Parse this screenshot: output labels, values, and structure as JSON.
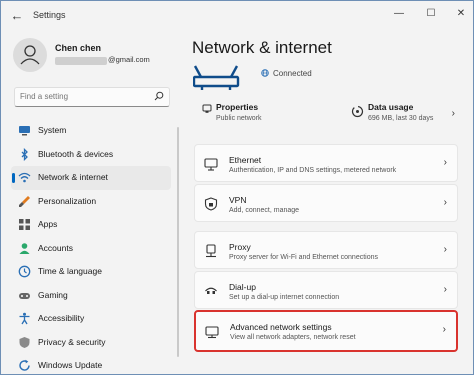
{
  "window": {
    "title": "Settings",
    "back_glyph": "←",
    "minimize_glyph": "—",
    "maximize_glyph": "☐",
    "close_glyph": "✕"
  },
  "user": {
    "name": "Chen chen",
    "email_suffix": "@gmail.com"
  },
  "search": {
    "placeholder": "Find a setting",
    "icon": "search-icon"
  },
  "sidebar": {
    "items": [
      {
        "label": "System",
        "icon": "system-icon",
        "active": false
      },
      {
        "label": "Bluetooth & devices",
        "icon": "bluetooth-icon",
        "active": false
      },
      {
        "label": "Network & internet",
        "icon": "wifi-icon",
        "active": true
      },
      {
        "label": "Personalization",
        "icon": "brush-icon",
        "active": false
      },
      {
        "label": "Apps",
        "icon": "apps-icon",
        "active": false
      },
      {
        "label": "Accounts",
        "icon": "person-icon",
        "active": false
      },
      {
        "label": "Time & language",
        "icon": "globe-clock-icon",
        "active": false
      },
      {
        "label": "Gaming",
        "icon": "gamepad-icon",
        "active": false
      },
      {
        "label": "Accessibility",
        "icon": "accessibility-icon",
        "active": false
      },
      {
        "label": "Privacy & security",
        "icon": "shield-icon",
        "active": false
      },
      {
        "label": "Windows Update",
        "icon": "update-icon",
        "active": false
      }
    ]
  },
  "main": {
    "title": "Network & internet",
    "status": "Connected",
    "properties": {
      "title": "Properties",
      "subtitle": "Public network"
    },
    "data_usage": {
      "title": "Data usage",
      "subtitle": "696 MB, last 30 days"
    },
    "chevron": "›",
    "cards": [
      {
        "title": "Ethernet",
        "subtitle": "Authentication, IP and DNS settings, metered network",
        "icon": "ethernet-icon"
      },
      {
        "title": "VPN",
        "subtitle": "Add, connect, manage",
        "icon": "vpn-shield-icon"
      },
      {
        "title": "Proxy",
        "subtitle": "Proxy server for Wi-Fi and Ethernet connections",
        "icon": "proxy-icon"
      },
      {
        "title": "Dial-up",
        "subtitle": "Set up a dial-up internet connection",
        "icon": "dialup-icon"
      },
      {
        "title": "Advanced network settings",
        "subtitle": "View all network adapters, network reset",
        "icon": "advanced-network-icon",
        "highlighted": true
      }
    ]
  },
  "colors": {
    "accent": "#0067c0",
    "highlight_border": "#d9332e",
    "background": "#f3f3f3"
  }
}
